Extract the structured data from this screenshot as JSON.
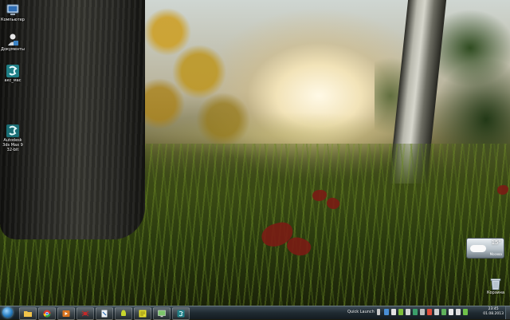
{
  "desktop": {
    "icons": [
      {
        "label": "Компьютер"
      },
      {
        "label": "Документы"
      },
      {
        "label": "акс_мас"
      },
      {
        "label": "Autodesk 3ds Max 9 32-bit"
      }
    ],
    "recycle_bin": {
      "label": "Корзина"
    }
  },
  "gadget": {
    "temperature": "15°",
    "city": "Москва"
  },
  "taskbar": {
    "quick_launch_label": "Quick Launch",
    "clock_time": "23:45",
    "clock_date": "01.08.2013",
    "colors": {
      "start_orb": "#2a7fc2",
      "bar_top": "#3d4b55",
      "bar_bottom": "#141c21"
    }
  }
}
